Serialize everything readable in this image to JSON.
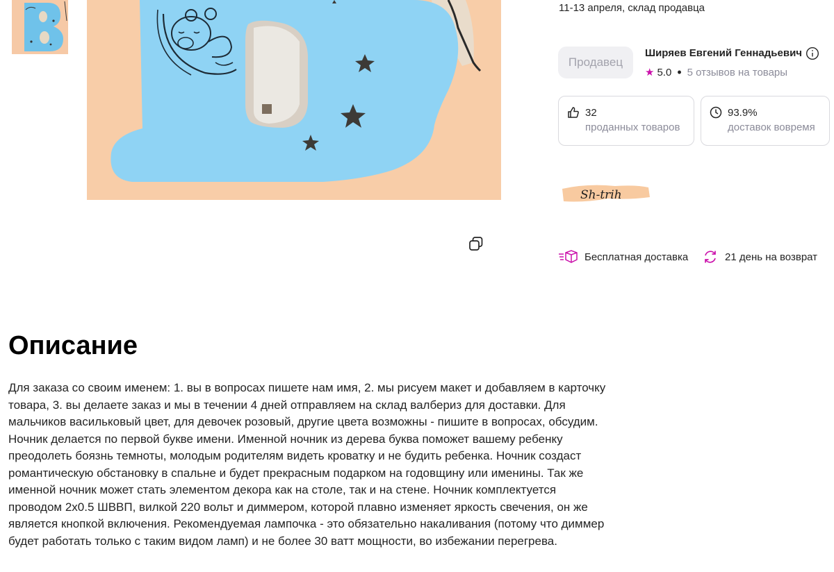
{
  "delivery": {
    "text": "11-13 апреля, склад продавца"
  },
  "seller": {
    "button_label": "Продавец",
    "name": "Ширяев Евгений Геннадьевич",
    "rating": "5.0",
    "reviews": "5 отзывов на товары"
  },
  "stats": [
    {
      "value": "32",
      "label": "проданных товаров",
      "icon": "thumbs-up-icon"
    },
    {
      "value": "93.9%",
      "label": "доставок вовремя",
      "icon": "clock-icon"
    }
  ],
  "brand": {
    "logo_text": "Sh-trih"
  },
  "features": [
    {
      "label": "Бесплатная доставка",
      "icon": "delivery-box-icon"
    },
    {
      "label": "21 день на возврат",
      "icon": "refresh-icon"
    }
  ],
  "description": {
    "title": "Описание",
    "text": "Для заказа со своим именем: 1. вы в вопросах пишете нам имя, 2. мы рисуем макет и добавляем в карточку товара, 3. вы делаете заказ и мы в течении 4 дней отправляем на склад валбериз для доставки. Для мальчиков васильковый цвет, для девочек розовый, другие цвета возможны - пишите в вопросах, обсудим. Ночник делается по первой букве имени. Именной ночник из дерева буква поможет вашему ребенку преодолеть боязнь темноты, молодым родителям видеть кроватку и не будить ребенка. Ночник создаст романтическую обстановку в спальне и будет прекрасным подарком на годовщину или именины. Так же именной ночник может стать элементом декора как на столе, так и на стене. Ночник комплектуется проводом 2х0.5 ШВВП, вилкой 220 вольт и диммером, которой плавно изменяет яркость свечения, он же является кнопкой включения. Рекомендуемая лампочка - это обязательно накаливания (потому что диммер будет работать только с таким видом ламп) и не более 30 ватт мощности, во избежании перегрева."
  },
  "colors": {
    "accent": "#cb11ab",
    "muted_text": "#8b8b99",
    "card_border": "#d9d9de",
    "letter_blue": "#8fd3f4",
    "photo_background": "#f8cda8"
  }
}
